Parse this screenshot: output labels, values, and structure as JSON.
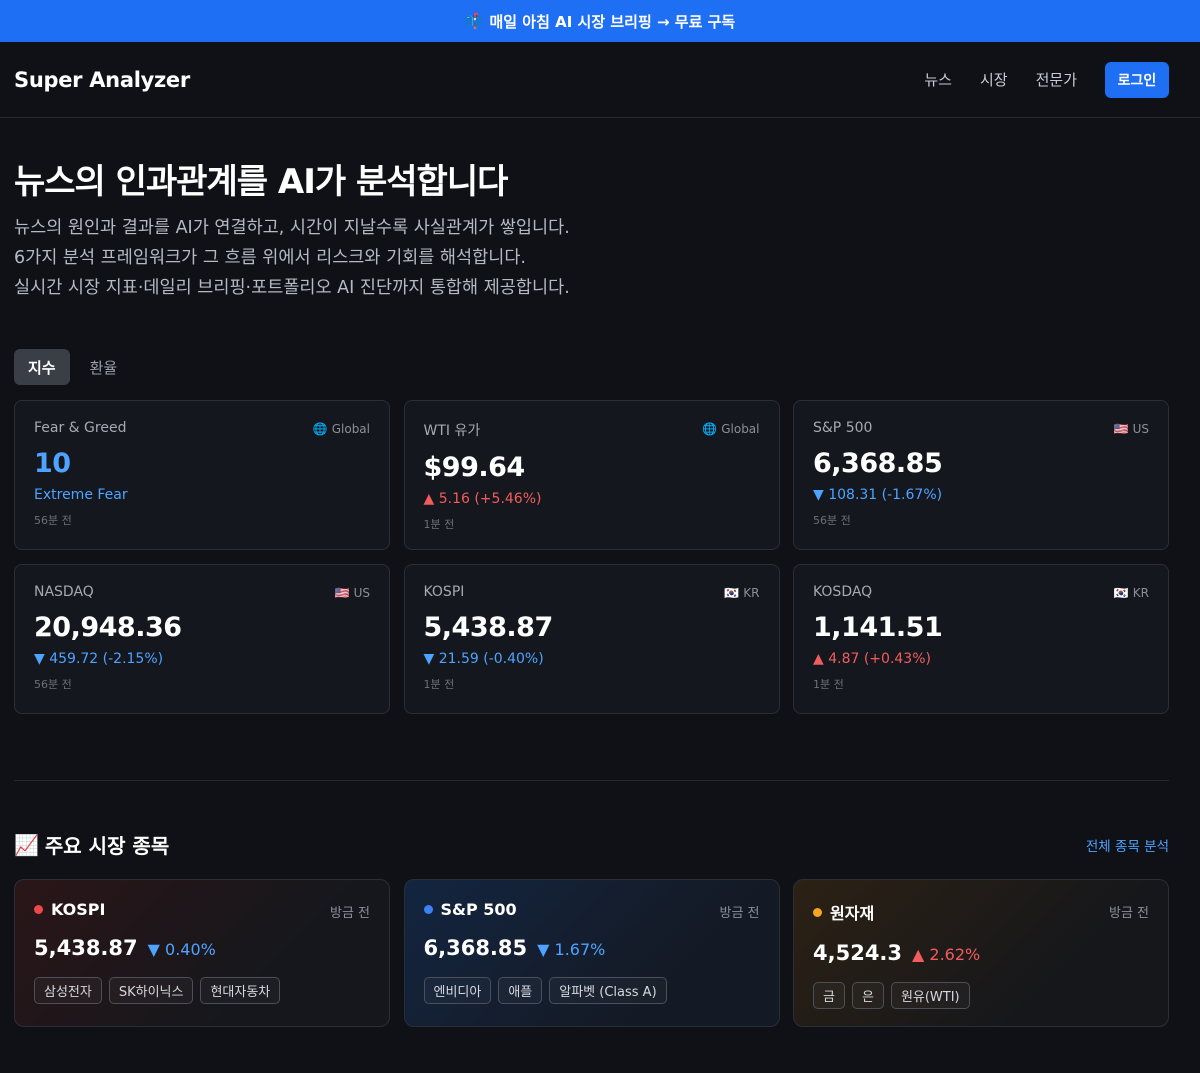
{
  "banner": {
    "icon": "mailbox-icon",
    "text": "매일 아침 AI 시장 브리핑 → 무료 구독"
  },
  "nav": {
    "logo": "Super Analyzer",
    "links": [
      "뉴스",
      "시장",
      "전문가"
    ],
    "login_label": "로그인",
    "accent": "#1f6ff5"
  },
  "hero": {
    "title": "뉴스의 인과관계를 AI가 분석합니다",
    "lines": [
      "뉴스의 원인과 결과를 AI가 연결하고, 시간이 지날수록 사실관계가 쌓입니다.",
      "6가지 분석 프레임워크가 그 흐름 위에서 리스크와 기회를 해석합니다.",
      "실시간 시장 지표·데일리 브리핑·포트폴리오 AI 진단까지 통합해 제공합니다."
    ]
  },
  "tabs": [
    {
      "label": "지수",
      "active": true
    },
    {
      "label": "환율",
      "active": false
    }
  ],
  "metrics": [
    {
      "name": "Fear & Greed",
      "region": "Global",
      "flag": "🌐",
      "value": "10",
      "change": "Extreme Fear",
      "dir": "none",
      "time": "56분 전"
    },
    {
      "name": "WTI 유가",
      "region": "Global",
      "flag": "🌐",
      "value": "$99.64",
      "change": "▲ 5.16 (+5.46%)",
      "dir": "up",
      "time": "1분 전"
    },
    {
      "name": "S&P 500",
      "region": "US",
      "flag": "🇺🇸",
      "value": "6,368.85",
      "change": "▼ 108.31 (-1.67%)",
      "dir": "down",
      "time": "56분 전"
    },
    {
      "name": "NASDAQ",
      "region": "US",
      "flag": "🇺🇸",
      "value": "20,948.36",
      "change": "▼ 459.72 (-2.15%)",
      "dir": "down",
      "time": "56분 전"
    },
    {
      "name": "KOSPI",
      "region": "KR",
      "flag": "🇰🇷",
      "value": "5,438.87",
      "change": "▼ 21.59 (-0.40%)",
      "dir": "down",
      "time": "1분 전"
    },
    {
      "name": "KOSDAQ",
      "region": "KR",
      "flag": "🇰🇷",
      "value": "1,141.51",
      "change": "▲ 4.87 (+0.43%)",
      "dir": "up",
      "time": "1분 전"
    }
  ],
  "section": {
    "icon": "chart-up-icon",
    "title": "주요 시장 종목",
    "all_link": "전체 종목 분석"
  },
  "markets": [
    {
      "name": "KOSPI",
      "dot_color": "#f04848",
      "time": "방금 전",
      "value": "5,438.87",
      "change": "▼ 0.40%",
      "dir": "down",
      "chips": [
        "삼성전자",
        "SK하이닉스",
        "현대자동차"
      ]
    },
    {
      "name": "S&P 500",
      "dot_color": "#3b82f6",
      "time": "방금 전",
      "value": "6,368.85",
      "change": "▼ 1.67%",
      "dir": "down",
      "chips": [
        "엔비디아",
        "애플",
        "알파벳 (Class A)"
      ]
    },
    {
      "name": "원자재",
      "dot_color": "#f5a524",
      "time": "방금 전",
      "value": "4,524.3",
      "change": "▲ 2.62%",
      "dir": "up",
      "chips": [
        "금",
        "은",
        "원유(WTI)"
      ]
    }
  ]
}
